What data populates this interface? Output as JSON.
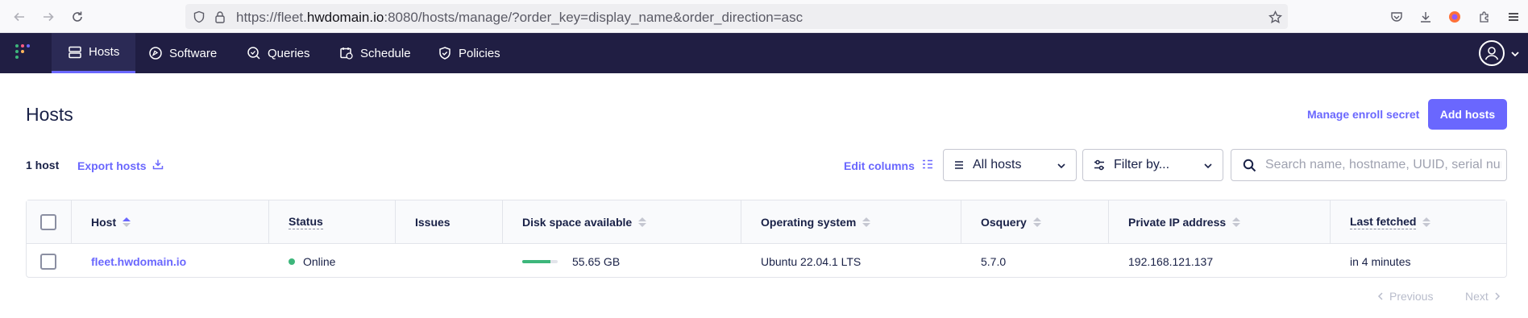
{
  "browser": {
    "url_scheme": "https://fleet.",
    "url_host": "hwdomain.io",
    "url_rest": ":8080/hosts/manage/?order_key=display_name&order_direction=asc"
  },
  "nav": {
    "items": [
      {
        "label": "Hosts",
        "icon": "hosts-icon",
        "active": true
      },
      {
        "label": "Software",
        "icon": "software-icon",
        "active": false
      },
      {
        "label": "Queries",
        "icon": "queries-icon",
        "active": false
      },
      {
        "label": "Schedule",
        "icon": "schedule-icon",
        "active": false
      },
      {
        "label": "Policies",
        "icon": "policies-icon",
        "active": false
      }
    ]
  },
  "page": {
    "title": "Hosts",
    "manage_enroll_label": "Manage enroll secret",
    "add_hosts_label": "Add hosts",
    "host_count": "1 host",
    "export_label": "Export hosts",
    "edit_columns_label": "Edit columns",
    "status_filter": "All hosts",
    "filter_by": "Filter by...",
    "search_placeholder": "Search name, hostname, UUID, serial number, or IP address"
  },
  "table": {
    "columns": [
      "Host",
      "Status",
      "Issues",
      "Disk space available",
      "Operating system",
      "Osquery",
      "Private IP address",
      "Last fetched"
    ],
    "rows": [
      {
        "host": "fleet.hwdomain.io",
        "status": "Online",
        "issues": "",
        "disk_space": "55.65 GB",
        "disk_fraction": 0.8,
        "os": "Ubuntu 22.04.1 LTS",
        "osquery": "5.7.0",
        "private_ip": "192.168.121.137",
        "last_fetched": "in 4 minutes"
      }
    ]
  },
  "pagination": {
    "previous": "Previous",
    "next": "Next"
  },
  "colors": {
    "accent": "#6a67fe",
    "header_bg": "#201e43",
    "online": "#3db67b"
  }
}
